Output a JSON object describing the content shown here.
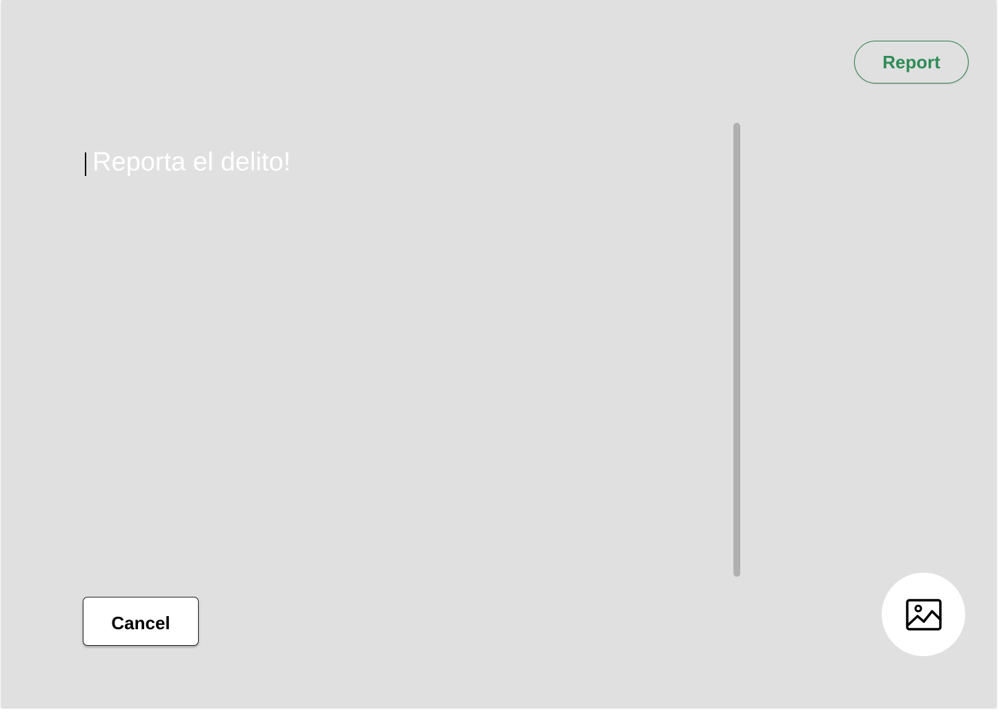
{
  "header": {
    "report_label": "Report",
    "accent_color": "#2e8b57"
  },
  "editor": {
    "placeholder": "Reporta el delito!",
    "value": ""
  },
  "footer": {
    "cancel_label": "Cancel",
    "image_button_icon": "image-icon"
  }
}
